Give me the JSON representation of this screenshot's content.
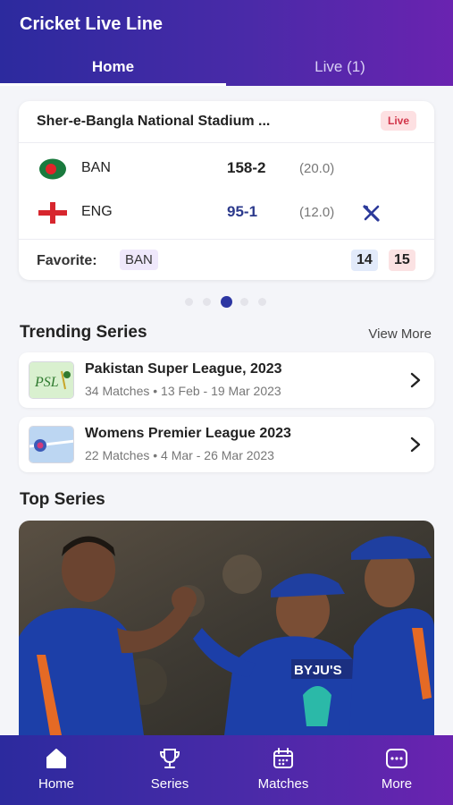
{
  "app": {
    "title": "Cricket Live Line"
  },
  "tabs": [
    {
      "label": "Home"
    },
    {
      "label": "Live (1)"
    }
  ],
  "match": {
    "venue": "Sher-e-Bangla National Stadium ...",
    "status": "Live",
    "teams": [
      {
        "name": "BAN",
        "score": "158-2",
        "overs": "(20.0)",
        "score_color": "#222222"
      },
      {
        "name": "ENG",
        "score": "95-1",
        "overs": "(12.0)",
        "score_color": "#2c3a8c"
      }
    ],
    "favorite_label": "Favorite:",
    "favorite_team": "BAN",
    "odds": {
      "back": "14",
      "lay": "15"
    }
  },
  "trending": {
    "title": "Trending Series",
    "view_more": "View More",
    "items": [
      {
        "name": "Pakistan Super League, 2023",
        "meta": "34 Matches • 13 Feb - 19 Mar 2023",
        "logo": "psl-logo"
      },
      {
        "name": "Womens Premier League 2023",
        "meta": "22 Matches • 4 Mar - 26 Mar 2023",
        "logo": "wpl-logo"
      }
    ]
  },
  "top_series": {
    "title": "Top Series"
  },
  "nav": [
    {
      "label": "Home",
      "icon": "home-icon"
    },
    {
      "label": "Series",
      "icon": "trophy-icon"
    },
    {
      "label": "Matches",
      "icon": "calendar-icon"
    },
    {
      "label": "More",
      "icon": "more-icon"
    }
  ],
  "colors": {
    "header_start": "#2c2a9e",
    "header_end": "#6a23b0",
    "live_badge": "#d2354a",
    "accent": "#2c36a2"
  }
}
